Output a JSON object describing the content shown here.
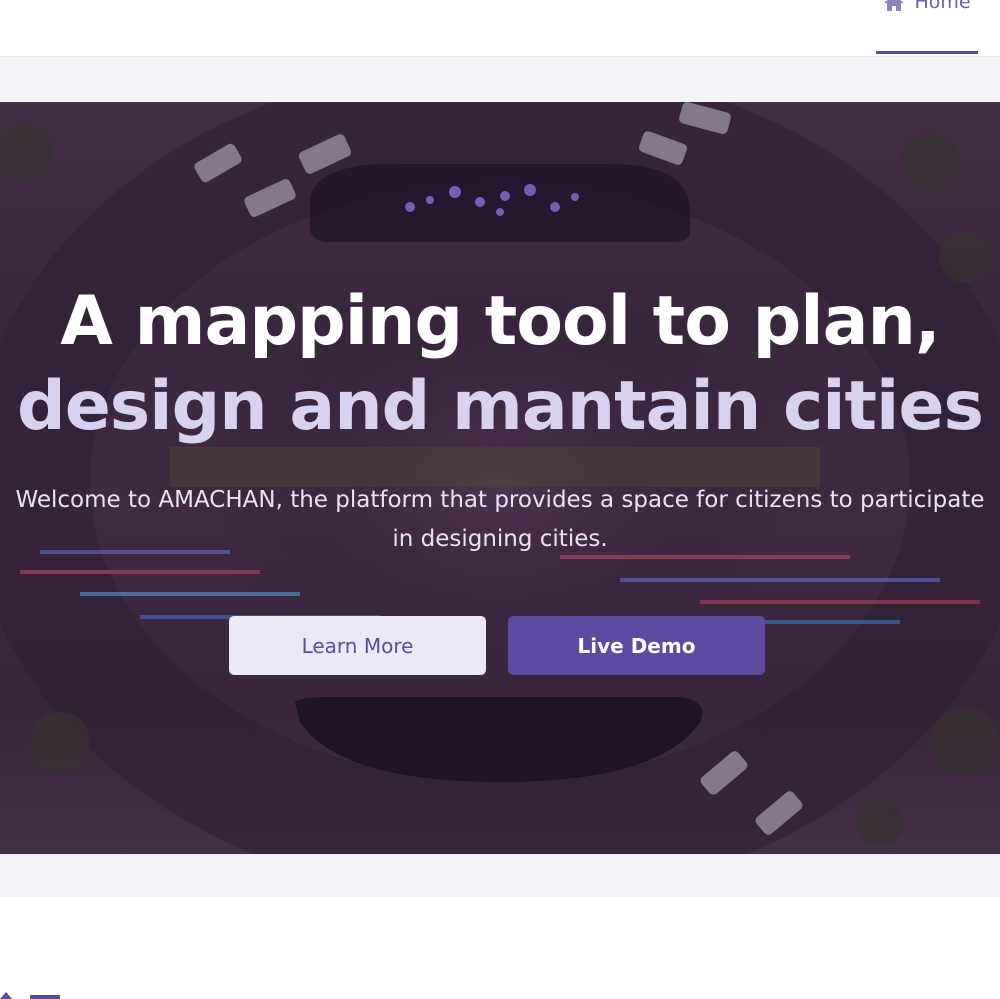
{
  "navbar": {
    "home_label": "Home",
    "home_icon": "home-icon",
    "accent": "#5b4b9e"
  },
  "hero": {
    "title_line1": "A mapping tool to plan,",
    "title_line2": "design and mantain cities",
    "subtitle_line1": "Welcome to AMACHAN, the platform that provides a space for citizens to participate",
    "subtitle_line2": "in designing cities.",
    "learn_more_label": "Learn More",
    "live_demo_label": "Live Demo"
  },
  "colors": {
    "primary": "#5d49a0",
    "secondary_button": "#ece8f6",
    "background_band": "#f1f3f8"
  }
}
